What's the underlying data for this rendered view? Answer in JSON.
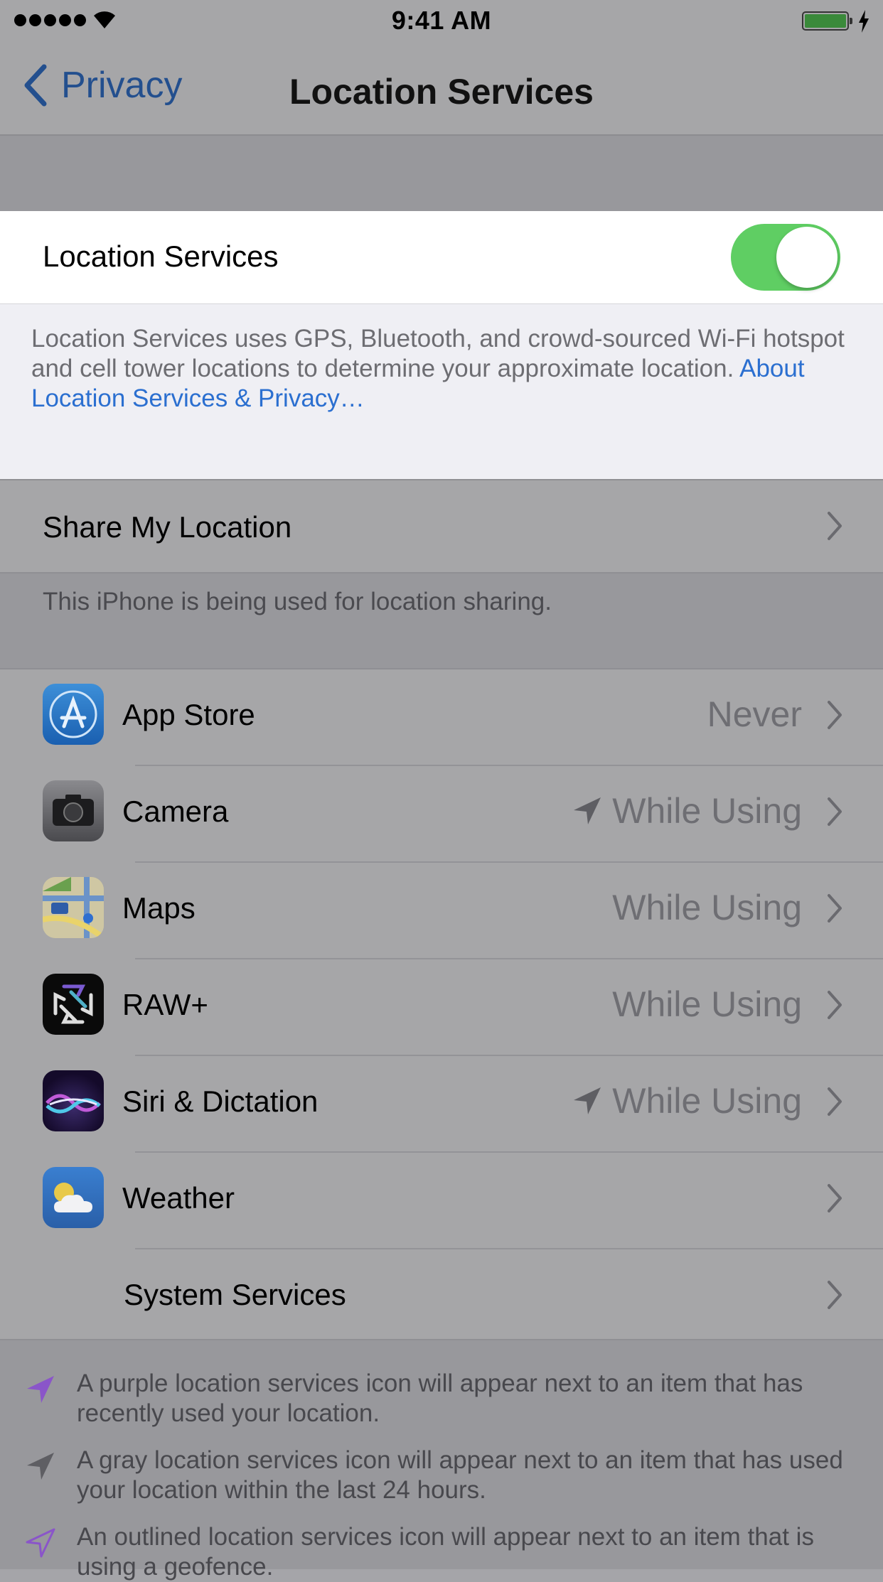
{
  "status_bar": {
    "time": "9:41 AM"
  },
  "nav": {
    "back_label": "Privacy",
    "title": "Location Services"
  },
  "main_toggle": {
    "label": "Location Services",
    "on": true,
    "color": "#5fce63"
  },
  "description": {
    "text": "Location Services uses GPS, Bluetooth, and crowd-sourced Wi-Fi hotspot and cell tower locations to determine your approximate location.",
    "link": "About Location Services & Privacy…"
  },
  "share": {
    "label": "Share My Location",
    "note": "This iPhone is being used for location sharing."
  },
  "apps": [
    {
      "name": "App Store",
      "status": "Never",
      "arrow": false,
      "icon": "app-store-icon"
    },
    {
      "name": "Camera",
      "status": "While Using",
      "arrow": true,
      "icon": "camera-icon"
    },
    {
      "name": "Maps",
      "status": "While Using",
      "arrow": false,
      "icon": "maps-icon"
    },
    {
      "name": "RAW+",
      "status": "While Using",
      "arrow": false,
      "icon": "raw-plus-icon"
    },
    {
      "name": "Siri & Dictation",
      "status": "While Using",
      "arrow": true,
      "icon": "siri-icon"
    },
    {
      "name": "Weather",
      "status": "",
      "arrow": false,
      "icon": "weather-icon"
    },
    {
      "name": "System Services",
      "status": "",
      "arrow": false,
      "icon": ""
    }
  ],
  "legend": [
    {
      "text": "A purple location services icon will appear next to an item that has recently used your location.",
      "color": "#8a55c9"
    },
    {
      "text": "A gray location services icon will appear next to an item that has used your location within the last 24 hours.",
      "color": "#5e5e63"
    },
    {
      "text": "An outlined location services icon will appear next to an item that is using a geofence.",
      "color": "#8a55c9"
    }
  ]
}
